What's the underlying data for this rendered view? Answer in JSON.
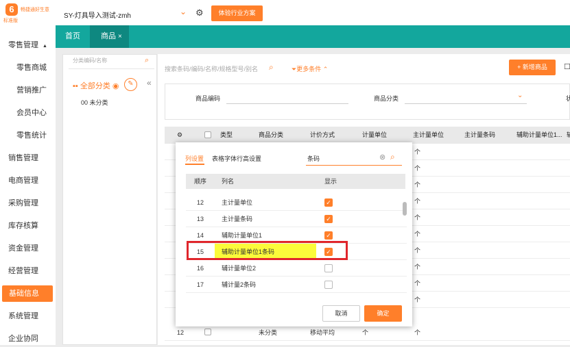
{
  "brand": {
    "name": "畅捷通好生意",
    "edition": "标准版",
    "logo_glyph": "6"
  },
  "header": {
    "account": "SY-灯具导入测试-zmh",
    "experience_button": "体验行业方案"
  },
  "sidebar": {
    "items": [
      {
        "label": "零售管理",
        "level": "top",
        "expanded": true
      },
      {
        "label": "零售商城",
        "level": "sub"
      },
      {
        "label": "营销推广",
        "level": "sub"
      },
      {
        "label": "会员中心",
        "level": "sub"
      },
      {
        "label": "零售统计",
        "level": "sub"
      },
      {
        "label": "销售管理",
        "level": "top"
      },
      {
        "label": "电商管理",
        "level": "top"
      },
      {
        "label": "采购管理",
        "level": "top"
      },
      {
        "label": "库存核算",
        "level": "top"
      },
      {
        "label": "资金管理",
        "level": "top"
      },
      {
        "label": "经营管理",
        "level": "top"
      },
      {
        "label": "基础信息",
        "level": "top",
        "active": true
      },
      {
        "label": "系统管理",
        "level": "top"
      },
      {
        "label": "企业协同",
        "level": "top"
      }
    ]
  },
  "tabs": [
    {
      "label": "首页"
    },
    {
      "label": "商品",
      "active": true
    }
  ],
  "category": {
    "search_placeholder": "分类编码/名称",
    "all_label": "全部分类",
    "uncategorized": "00 未分类"
  },
  "toolbar": {
    "search_placeholder": "搜索条码/编码/名称/规格型号/别名",
    "more_conditions": "更多条件",
    "add_button": "+ 新增商品"
  },
  "filters": {
    "code_label": "商品编码",
    "category_label": "商品分类",
    "third_label": "状"
  },
  "grid": {
    "columns": [
      "类型",
      "商品分类",
      "计价方式",
      "计量单位",
      "主计量单位",
      "主计量条码",
      "辅助计量单位1...",
      "辅"
    ],
    "row_cells": [
      "个",
      "个",
      "个",
      "个",
      "个",
      "个",
      "个",
      "个",
      "个",
      "个"
    ],
    "last_row": {
      "index": "12",
      "category": "未分类",
      "pricing": "移动平均",
      "unit": "个",
      "main_unit": "个"
    }
  },
  "modal": {
    "tab_columns": "列设置",
    "tab_font": "表格字体行高设置",
    "search_value": "条码",
    "headers": {
      "seq": "顺序",
      "name": "列名",
      "show": "显示"
    },
    "rows": [
      {
        "seq": "12",
        "name": "主计量单位",
        "checked": true
      },
      {
        "seq": "13",
        "name": "主计量条码",
        "checked": true
      },
      {
        "seq": "14",
        "name": "辅助计量单位1",
        "checked": true
      },
      {
        "seq": "15",
        "name": "辅助计量单位1条码",
        "checked": true,
        "highlighted": true
      },
      {
        "seq": "16",
        "name": "辅计量单位2",
        "checked": false
      },
      {
        "seq": "17",
        "name": "辅计量2条码",
        "checked": false
      }
    ],
    "cancel": "取消",
    "ok": "确定"
  },
  "colors": {
    "accent": "#ff7f2a",
    "tabbar": "#13a79d",
    "highlight": "#fbfb3a",
    "annotation": "#e0262c"
  }
}
